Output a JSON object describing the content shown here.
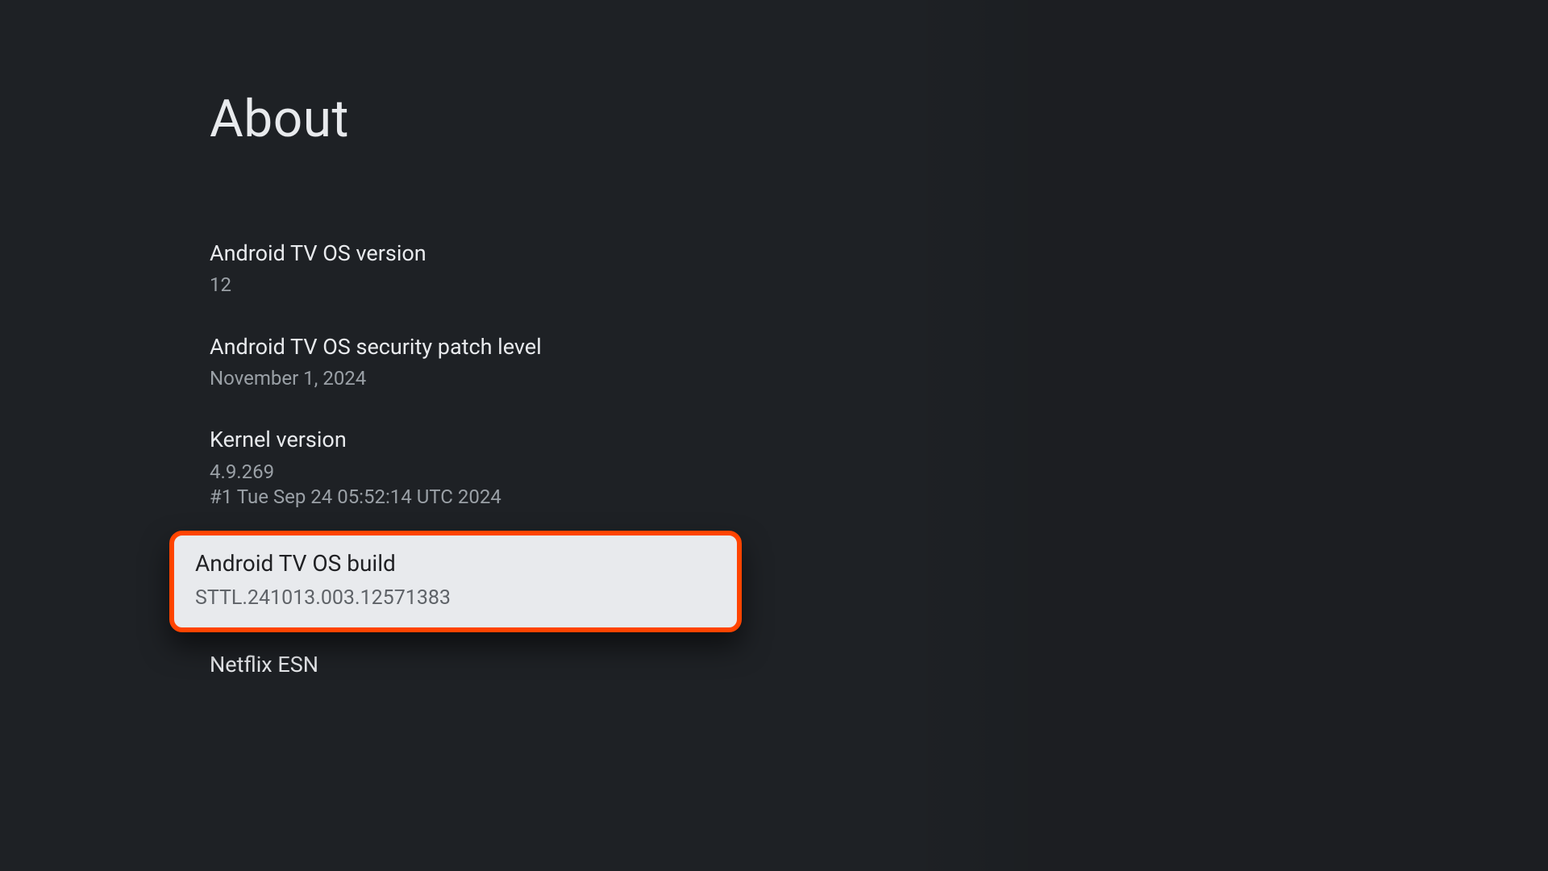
{
  "header": {
    "title": "About"
  },
  "items": [
    {
      "key": "os-version",
      "title": "Android TV OS version",
      "subtitle": "12",
      "focused": false
    },
    {
      "key": "security-patch",
      "title": "Android TV OS security patch level",
      "subtitle": "November 1, 2024",
      "focused": false
    },
    {
      "key": "kernel-version",
      "title": "Kernel version",
      "subtitle": "4.9.269\n#1 Tue Sep 24 05:52:14 UTC 2024",
      "focused": false
    },
    {
      "key": "os-build",
      "title": "Android TV OS build",
      "subtitle": "STTL.241013.003.12571383",
      "focused": true
    },
    {
      "key": "netflix-esn",
      "title": "Netflix ESN",
      "subtitle": "",
      "focused": false
    }
  ],
  "colors": {
    "background": "#1e2125",
    "text_primary": "#e8eaed",
    "text_secondary": "#9aa0a6",
    "highlight_bg": "#e8eaed",
    "highlight_border": "#ff4400"
  }
}
